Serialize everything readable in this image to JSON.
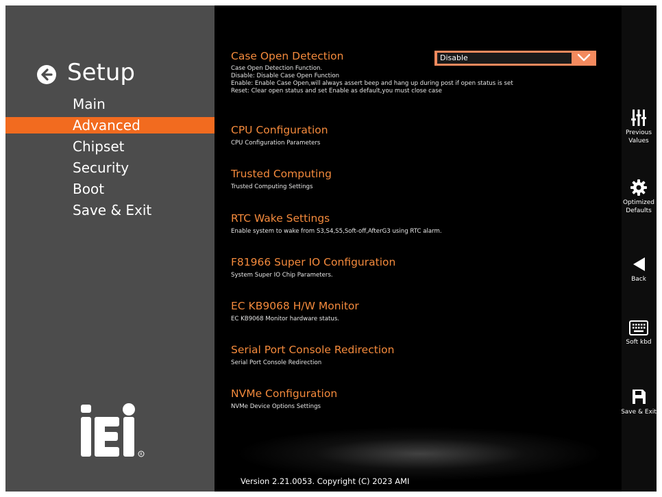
{
  "nav": {
    "title": "Setup",
    "items": [
      {
        "label": "Main"
      },
      {
        "label": "Advanced"
      },
      {
        "label": "Chipset"
      },
      {
        "label": "Security"
      },
      {
        "label": "Boot"
      },
      {
        "label": "Save & Exit"
      }
    ],
    "active_item": "Advanced"
  },
  "logo_text": "iEi",
  "main": {
    "entries": [
      {
        "title": "Case Open Detection",
        "description": [
          "Case Open Detection Function.",
          "Disable: Disable Case Open Function",
          "Enable: Enable Case Open,will always assert beep and hang up during post if open status is set",
          "Reset: Clear open status and set Enable as default,you must close case"
        ]
      },
      {
        "title": "CPU Configuration",
        "description": [
          "CPU Configuration Parameters"
        ]
      },
      {
        "title": "Trusted Computing",
        "description": [
          "Trusted Computing Settings"
        ]
      },
      {
        "title": "RTC Wake Settings",
        "description": [
          "Enable system to wake from S3,S4,S5,Soft-off,AfterG3 using RTC alarm."
        ]
      },
      {
        "title": "F81966 Super IO Configuration",
        "description": [
          "System Super IO Chip Parameters."
        ]
      },
      {
        "title": "EC KB9068 H/W Monitor",
        "description": [
          "EC KB9068 Monitor hardware status."
        ]
      },
      {
        "title": "Serial Port Console Redirection",
        "description": [
          "Serial Port Console Redirection"
        ]
      },
      {
        "title": "NVMe Configuration",
        "description": [
          "NVMe Device Options Settings"
        ]
      }
    ],
    "case_open_value": "Disable",
    "version": "Version 2.21.0053. Copyright (C) 2023 AMI"
  },
  "toolbar": {
    "previous_values": "Previous\nValues",
    "optimized_defaults": "Optimized\nDefaults",
    "back": "Back",
    "soft_kbd": "Soft kbd",
    "save_exit": "Save & Exit"
  },
  "colors": {
    "accent": "#f26b1f",
    "title_orange": "#f48a3c",
    "left_panel": "#4c4c4c",
    "dropdown": "#f48a5e"
  }
}
